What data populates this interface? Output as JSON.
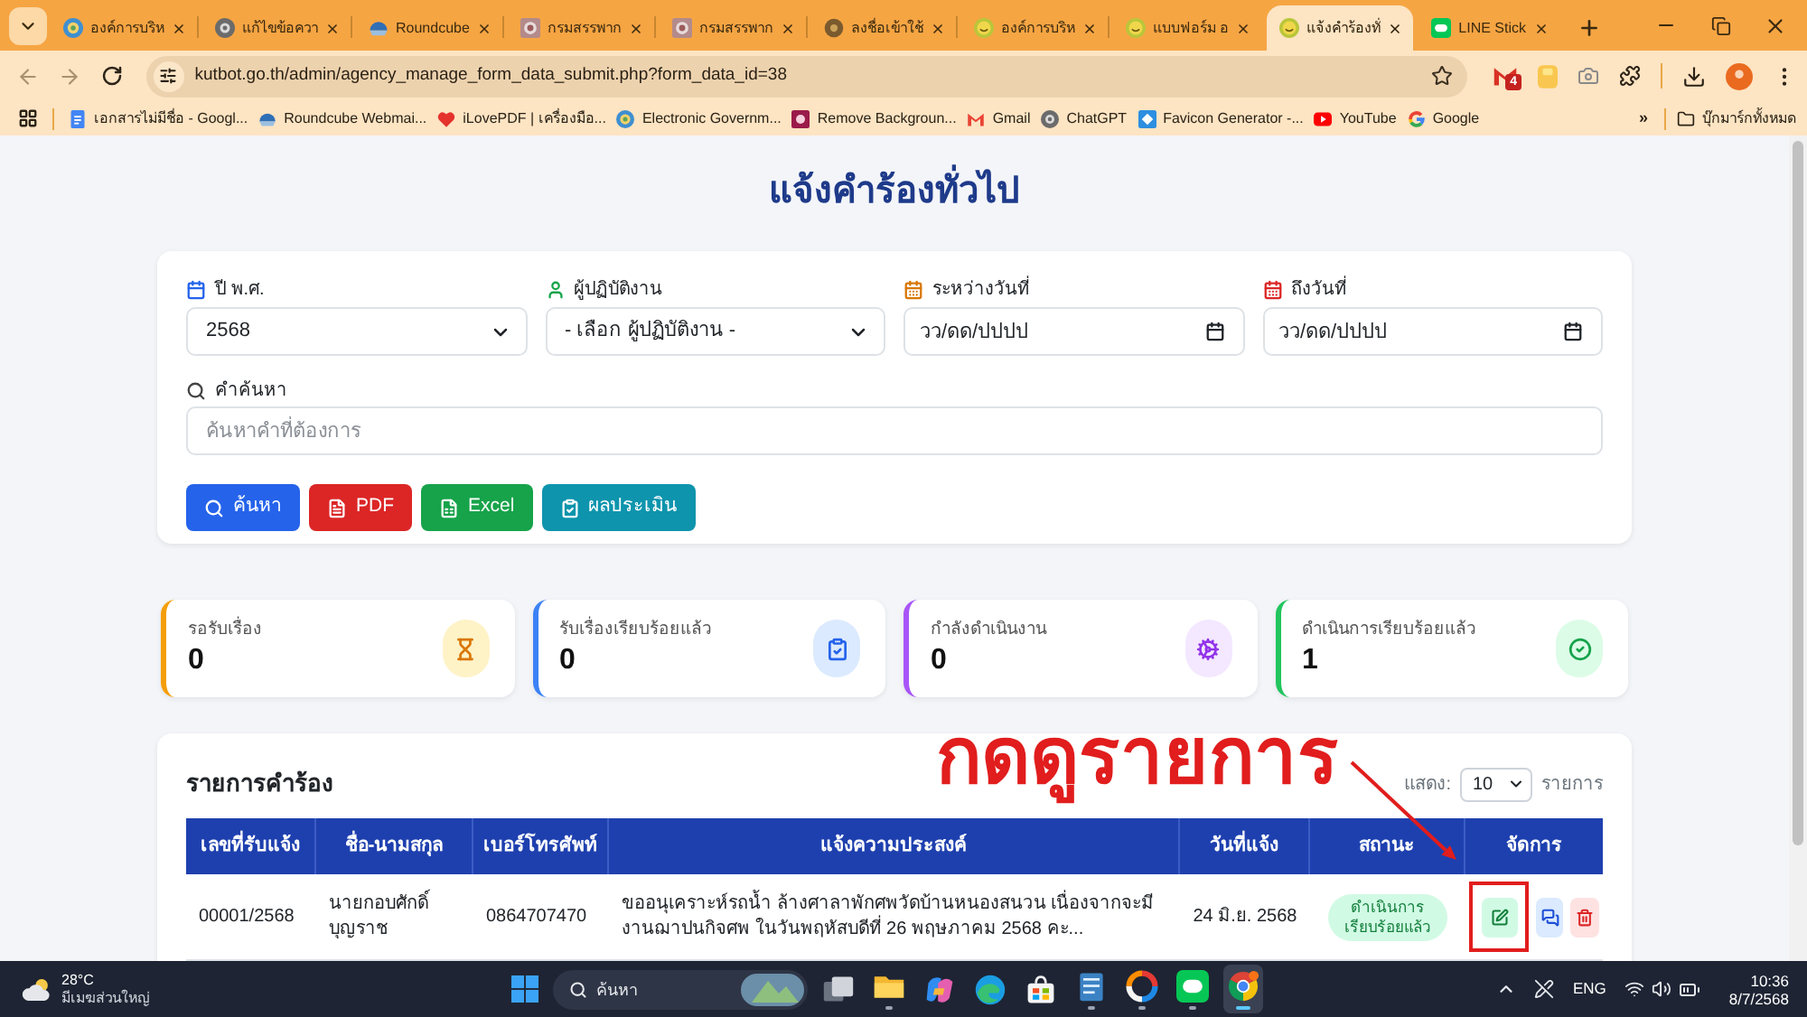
{
  "browser": {
    "tabs": [
      {
        "title": "องค์การบริห",
        "kind": "emblem",
        "selected": false
      },
      {
        "title": "แก้ไขข้อควา",
        "kind": "gear",
        "selected": false
      },
      {
        "title": "Roundcube",
        "kind": "dome",
        "selected": false
      },
      {
        "title": "กรมสรรพาก",
        "kind": "seal",
        "selected": false
      },
      {
        "title": "กรมสรรพาก",
        "kind": "seal",
        "selected": false
      },
      {
        "title": "ลงชื่อเข้าใช้",
        "kind": "flower",
        "selected": false
      },
      {
        "title": "องค์การบริห",
        "kind": "smiley",
        "selected": false
      },
      {
        "title": "แบบฟอร์ม อ",
        "kind": "smiley",
        "selected": false
      },
      {
        "title": "แจ้งคำร้องทั่",
        "kind": "smiley",
        "selected": true
      },
      {
        "title": "LINE Stick",
        "kind": "chat",
        "selected": false
      }
    ],
    "url": "kutbot.go.th/admin/agency_manage_form_data_submit.php?form_data_id=38",
    "mail_badge": "4",
    "bookmarks": [
      {
        "label": "เอกสารไม่มีชื่อ - Googl...",
        "kind": "doc"
      },
      {
        "label": "Roundcube Webmai...",
        "kind": "dome"
      },
      {
        "label": "iLovePDF | เครื่องมือ...",
        "kind": "heart"
      },
      {
        "label": "Electronic Governm...",
        "kind": "emblem"
      },
      {
        "label": "Remove Backgroun...",
        "kind": "square"
      },
      {
        "label": "Gmail",
        "kind": "mail"
      },
      {
        "label": "ChatGPT",
        "kind": "gear"
      },
      {
        "label": "Favicon Generator -...",
        "kind": "tile"
      },
      {
        "label": "YouTube",
        "kind": "play"
      },
      {
        "label": "Google",
        "kind": "ring"
      }
    ],
    "more": "»",
    "all_bookmarks": "บุ๊กมาร์กทั้งหมด"
  },
  "page": {
    "title": "แจ้งคำร้องทั่วไป",
    "filters": [
      {
        "label": "ปี พ.ศ.",
        "kind": "year",
        "color": "#2563eb",
        "value": "2568"
      },
      {
        "label": "ผู้ปฏิบัติงาน",
        "kind": "staff",
        "color": "#16a34a",
        "value": "- เลือก ผู้ปฏิบัติงาน -"
      },
      {
        "label": "ระหว่างวันที่",
        "kind": "date",
        "color": "#d97706",
        "placeholder": "วว/ดด/ปปปป"
      },
      {
        "label": "ถึงวันที่",
        "kind": "date",
        "color": "#dc2626",
        "placeholder": "วว/ดด/ปปปป"
      }
    ],
    "search": {
      "label": "คำค้นหา",
      "placeholder": "ค้นหาคำที่ต้องการ"
    },
    "buttons": [
      {
        "label": "ค้นหา",
        "kind": "search",
        "color": "#2563eb"
      },
      {
        "label": "PDF",
        "kind": "pdf",
        "color": "#dc2626"
      },
      {
        "label": "Excel",
        "kind": "excel",
        "color": "#16a34a"
      },
      {
        "label": "ผลประเมิน",
        "kind": "evaluation",
        "color": "#0e94ad"
      }
    ],
    "stats": [
      {
        "label": "รอรับเรื่อง",
        "value": "0",
        "kind": "pending",
        "color": "#f59e0b"
      },
      {
        "label": "รับเรื่องเรียบร้อยแล้ว",
        "value": "0",
        "kind": "received",
        "color": "#3b82f6"
      },
      {
        "label": "กำลังดำเนินงาน",
        "value": "0",
        "kind": "working",
        "color": "#a855f7"
      },
      {
        "label": "ดำเนินการเรียบร้อยแล้ว",
        "value": "1",
        "kind": "done",
        "color": "#22c55e"
      }
    ],
    "table": {
      "title": "รายการคำร้อง",
      "page_size": {
        "label": "แสดง:",
        "value": "10",
        "unit": "รายการ"
      },
      "columns": [
        "เลขที่รับแจ้ง",
        "ชื่อ-นามสกุล",
        "เบอร์โทรศัพท์",
        "แจ้งความประสงค์",
        "วันที่แจ้ง",
        "สถานะ",
        "จัดการ"
      ],
      "rows": [
        {
          "number": "00001/2568",
          "name": "นายกอบศักดิ์ บุญราช",
          "phone": "0864707470",
          "request": "ขออนุเคราะห์รถน้ำ ล้างศาลาพักศพวัดบ้านหนองสนวน เนื่องจากจะมีงานฌาปนกิจศพ ในวันพฤหัสบดีที่ 26 พฤษภาคม 2568 คะ...",
          "date": "24 มิ.ย. 2568",
          "status": {
            "label": "ดำเนินการเรียบร้อยแล้ว",
            "kind": "done"
          },
          "actions": [
            {
              "kind": "edit",
              "highlighted": true
            },
            {
              "kind": "chat",
              "highlighted": false
            },
            {
              "kind": "delete",
              "highlighted": false
            }
          ]
        }
      ]
    }
  },
  "annotation": {
    "text": "กดดูรายการ"
  },
  "taskbar": {
    "weather": {
      "temperature": "28°C",
      "condition": "มีเมฆส่วนใหญ่"
    },
    "search": {
      "placeholder": "ค้นหา"
    },
    "apps": [
      {
        "kind": "taskview",
        "open": false,
        "selected": false
      },
      {
        "kind": "folder",
        "open": true,
        "selected": false
      },
      {
        "kind": "copilot",
        "open": false,
        "selected": false
      },
      {
        "kind": "edge",
        "open": false,
        "selected": false
      },
      {
        "kind": "store",
        "open": false,
        "selected": false
      },
      {
        "kind": "notepad",
        "open": true,
        "selected": false
      },
      {
        "kind": "ring",
        "open": true,
        "selected": false
      },
      {
        "kind": "chat",
        "open": true,
        "selected": false
      },
      {
        "kind": "chrome",
        "open": true,
        "selected": true
      }
    ],
    "language": "ENG",
    "time": "10:36",
    "date": "8/7/2568"
  }
}
